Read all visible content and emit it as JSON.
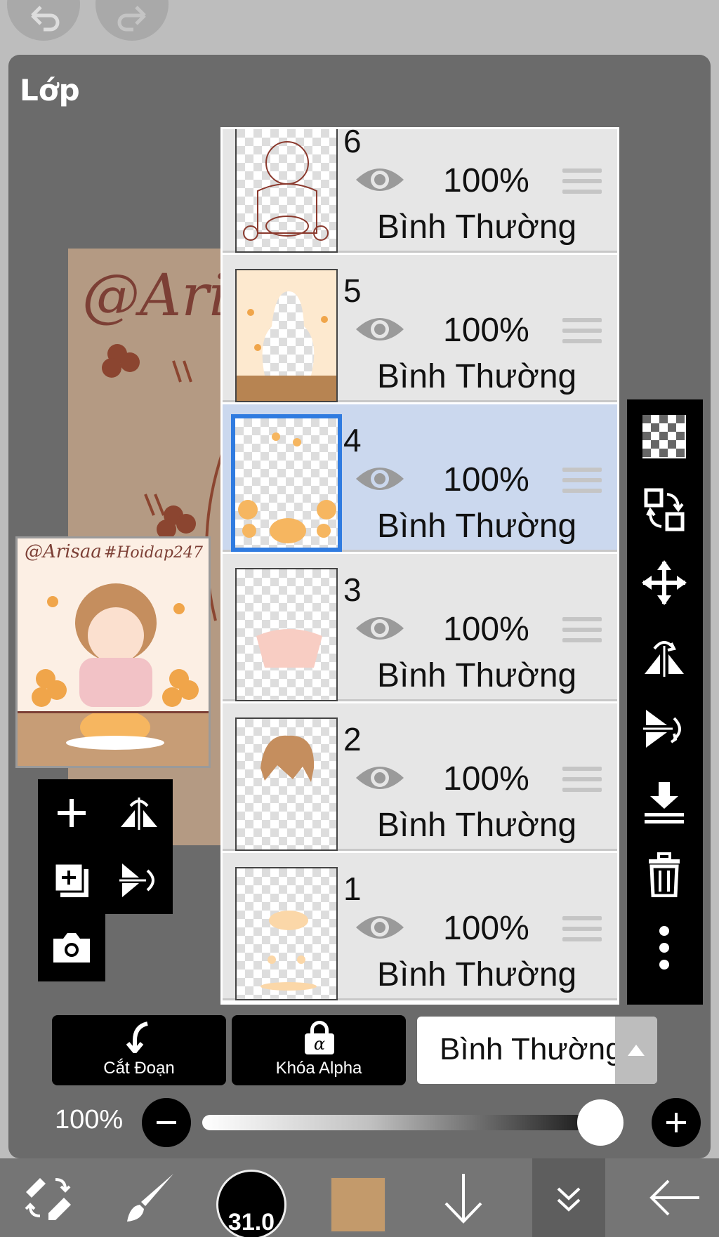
{
  "panel": {
    "title": "Lớp"
  },
  "canvas": {
    "watermark": "@Aris"
  },
  "preview": {
    "handle": "@Arisaa",
    "tag": "#Hoidap247"
  },
  "layers": [
    {
      "number": "6",
      "opacity": "100%",
      "blend": "Bình Thường",
      "visible": true,
      "selected": false
    },
    {
      "number": "5",
      "opacity": "100%",
      "blend": "Bình Thường",
      "visible": true,
      "selected": false
    },
    {
      "number": "4",
      "opacity": "100%",
      "blend": "Bình Thường",
      "visible": true,
      "selected": true
    },
    {
      "number": "3",
      "opacity": "100%",
      "blend": "Bình Thường",
      "visible": true,
      "selected": false
    },
    {
      "number": "2",
      "opacity": "100%",
      "blend": "Bình Thường",
      "visible": true,
      "selected": false
    },
    {
      "number": "1",
      "opacity": "100%",
      "blend": "Bình Thường",
      "visible": true,
      "selected": false
    }
  ],
  "buttons": {
    "clip_label": "Cắt Đoạn",
    "alpha_lock_label": "Khóa Alpha",
    "alpha_symbol": "α"
  },
  "blend_mode": {
    "value": "Bình Thường"
  },
  "opacity": {
    "label": "100%",
    "value": 1.0
  },
  "brush": {
    "size": "31.0"
  },
  "colors": {
    "current": "#c39a6b",
    "selected_border": "#2f7be0",
    "selected_bg": "#cbd8ee"
  },
  "icons": {
    "top": [
      "undo-icon",
      "redo-icon"
    ],
    "left_tools": [
      "add-layer-icon",
      "flip-horizontal-icon",
      "duplicate-layer-icon",
      "flip-vertical-icon",
      "camera-icon"
    ],
    "right_tools": [
      "transparency-icon",
      "swap-icon",
      "move-icon",
      "flip-horizontal-icon",
      "flip-vertical-icon",
      "merge-down-icon",
      "trash-icon",
      "more-icon"
    ],
    "bottom": [
      "transform-icon",
      "brush-icon",
      "brush-size-icon",
      "color-icon",
      "down-arrow-icon",
      "layers-icon",
      "back-icon"
    ]
  }
}
